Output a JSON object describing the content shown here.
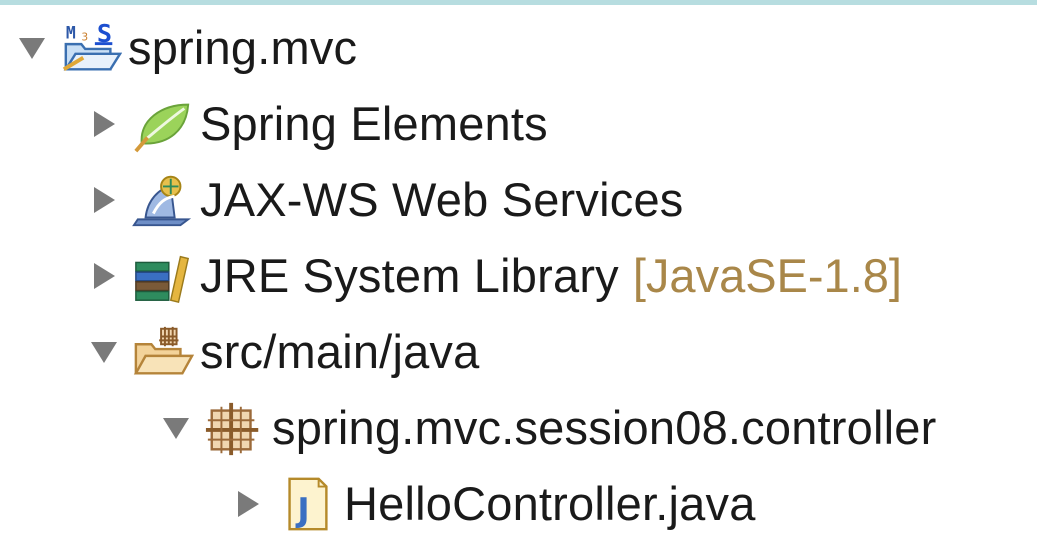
{
  "colors": {
    "twisty": "#7a7a7a",
    "decoration": "#a98749",
    "top_rule": "#b7dde0"
  },
  "tree": {
    "project": {
      "label": "spring.mvc",
      "icon": "maven-spring-project-icon",
      "expanded": true
    },
    "spring_elements": {
      "label": "Spring Elements",
      "icon": "spring-leaf-icon",
      "expanded": false
    },
    "jaxws": {
      "label": "JAX-WS Web Services",
      "icon": "web-services-icon",
      "expanded": false
    },
    "jre": {
      "label": "JRE System Library",
      "decoration": "[JavaSE-1.8]",
      "icon": "library-books-icon",
      "expanded": false
    },
    "src": {
      "label": "src/main/java",
      "icon": "source-folder-icon",
      "expanded": true
    },
    "package": {
      "label": "spring.mvc.session08.controller",
      "icon": "package-icon",
      "expanded": true
    },
    "file": {
      "label": "HelloController.java",
      "icon": "java-file-icon",
      "expanded": false
    }
  }
}
